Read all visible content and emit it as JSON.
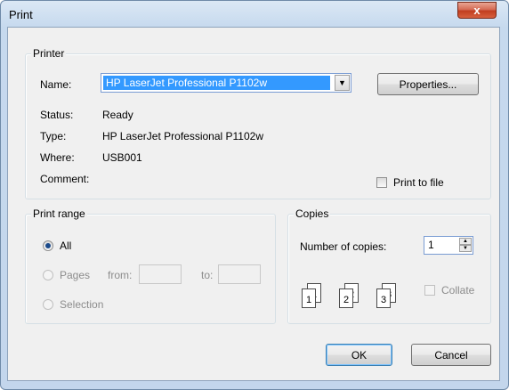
{
  "window": {
    "title": "Print",
    "close_label": "x"
  },
  "printer": {
    "group_label": "Printer",
    "name_label": "Name:",
    "name_value": "HP LaserJet Professional P1102w",
    "properties_button": "Properties...",
    "status_label": "Status:",
    "status_value": "Ready",
    "type_label": "Type:",
    "type_value": "HP LaserJet Professional P1102w",
    "where_label": "Where:",
    "where_value": "USB001",
    "comment_label": "Comment:",
    "print_to_file_label": "Print to file"
  },
  "print_range": {
    "group_label": "Print range",
    "all_label": "All",
    "pages_label": "Pages",
    "from_label": "from:",
    "to_label": "to:",
    "selection_label": "Selection"
  },
  "copies": {
    "group_label": "Copies",
    "number_label": "Number of copies:",
    "number_value": "1",
    "collate_label": "Collate",
    "collate_pages": [
      "1",
      "2",
      "3"
    ]
  },
  "buttons": {
    "ok": "OK",
    "cancel": "Cancel"
  }
}
